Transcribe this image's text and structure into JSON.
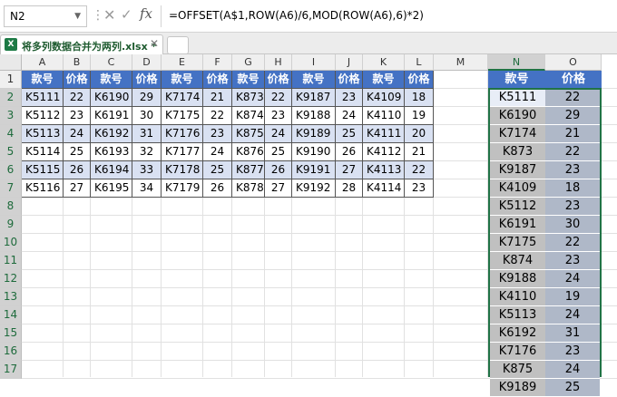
{
  "formula_bar": {
    "name_box": "N2",
    "formula": "=OFFSET(A$1,ROW(A6)/6,MOD(ROW(A6),6)*2)"
  },
  "tab": {
    "file_name": "将多列数据合并为两列.xlsx",
    "modified_mark": "*",
    "icon_letter": "X"
  },
  "icons": {
    "namebox_dropdown": "chevron-down-icon",
    "cancel": "close-icon",
    "enter": "check-icon",
    "insert_function": "fx-icon",
    "tab_close": "close-icon"
  },
  "columns": [
    "A",
    "B",
    "C",
    "D",
    "E",
    "F",
    "G",
    "H",
    "I",
    "J",
    "K",
    "L",
    "M",
    "N",
    "O"
  ],
  "rows": [
    "1",
    "2",
    "3",
    "4",
    "5",
    "6",
    "7",
    "8",
    "9",
    "10",
    "11",
    "12",
    "13",
    "14",
    "15",
    "16",
    "17"
  ],
  "table": {
    "header": [
      "款号",
      "价格",
      "款号",
      "价格",
      "款号",
      "价格",
      "款号",
      "价格",
      "款号",
      "价格",
      "款号",
      "价格"
    ],
    "rows": [
      [
        "K5111",
        "22",
        "K6190",
        "29",
        "K7174",
        "21",
        "K873",
        "22",
        "K9187",
        "23",
        "K4109",
        "18"
      ],
      [
        "K5112",
        "23",
        "K6191",
        "30",
        "K7175",
        "22",
        "K874",
        "23",
        "K9188",
        "24",
        "K4110",
        "19"
      ],
      [
        "K5113",
        "24",
        "K6192",
        "31",
        "K7176",
        "23",
        "K875",
        "24",
        "K9189",
        "25",
        "K4111",
        "20"
      ],
      [
        "K5114",
        "25",
        "K6193",
        "32",
        "K7177",
        "24",
        "K876",
        "25",
        "K9190",
        "26",
        "K4112",
        "21"
      ],
      [
        "K5115",
        "26",
        "K6194",
        "33",
        "K7178",
        "25",
        "K877",
        "26",
        "K9191",
        "27",
        "K4113",
        "22"
      ],
      [
        "K5116",
        "27",
        "K6195",
        "34",
        "K7179",
        "26",
        "K878",
        "27",
        "K9192",
        "28",
        "K4114",
        "23"
      ]
    ]
  },
  "result": {
    "header": [
      "款号",
      "价格"
    ],
    "rows": [
      [
        "K5111",
        "22"
      ],
      [
        "K6190",
        "29"
      ],
      [
        "K7174",
        "21"
      ],
      [
        "K873",
        "22"
      ],
      [
        "K9187",
        "23"
      ],
      [
        "K4109",
        "18"
      ],
      [
        "K5112",
        "23"
      ],
      [
        "K6191",
        "30"
      ],
      [
        "K7175",
        "22"
      ],
      [
        "K874",
        "23"
      ],
      [
        "K9188",
        "24"
      ],
      [
        "K4110",
        "19"
      ],
      [
        "K5113",
        "24"
      ],
      [
        "K6192",
        "31"
      ],
      [
        "K7176",
        "23"
      ],
      [
        "K875",
        "24"
      ],
      [
        "K9189",
        "25"
      ]
    ]
  },
  "colors": {
    "header_fill": "#4472c4",
    "band_fill": "#d9e1f2",
    "result_code_fill": "#c0c0c0",
    "result_price_fill": "#afb8c8",
    "selection_border": "#217346"
  }
}
